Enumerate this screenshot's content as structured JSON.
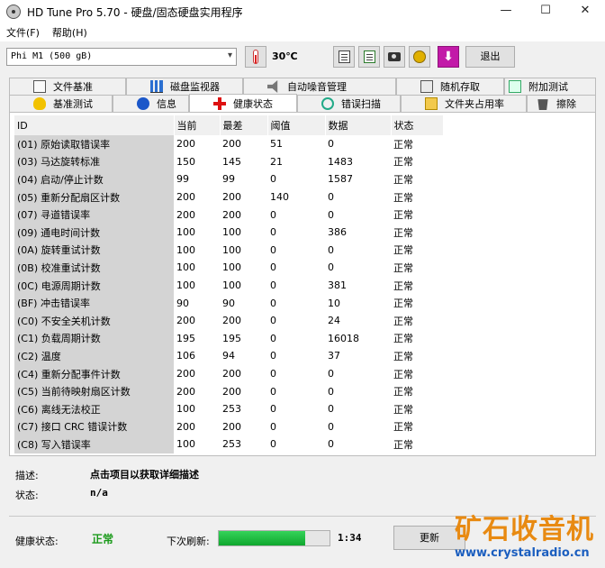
{
  "window": {
    "title": "HD Tune Pro 5.70 - 硬盘/固态硬盘实用程序",
    "controls": {
      "minimize": "—",
      "maximize": "☐",
      "close": "✕"
    }
  },
  "menu": {
    "file": "文件(F)",
    "help": "帮助(H)"
  },
  "toolbar": {
    "drive": "Phi     M1 (500 gB)",
    "temperature": "30℃",
    "exit_label": "退出",
    "icons": [
      "thermometer-icon",
      "copy-text-icon",
      "copy-report-icon",
      "camera-icon",
      "coins-icon",
      "download-icon"
    ]
  },
  "tabs": {
    "row1": [
      "文件基准",
      "磁盘监视器",
      "自动噪音管理",
      "随机存取",
      "附加测试"
    ],
    "row2": [
      "基准测试",
      "信息",
      "健康状态",
      "错误扫描",
      "文件夹占用率",
      "擦除"
    ],
    "active": "健康状态"
  },
  "health_table": {
    "headers": [
      "ID",
      "当前",
      "最差",
      "阈值",
      "数据",
      "状态"
    ],
    "rows": [
      [
        "(01) 原始读取错误率",
        "200",
        "200",
        "51",
        "0",
        "正常"
      ],
      [
        "(03) 马达旋转标准",
        "150",
        "145",
        "21",
        "1483",
        "正常"
      ],
      [
        "(04) 启动/停止计数",
        "99",
        "99",
        "0",
        "1587",
        "正常"
      ],
      [
        "(05) 重新分配扇区计数",
        "200",
        "200",
        "140",
        "0",
        "正常"
      ],
      [
        "(07) 寻道错误率",
        "200",
        "200",
        "0",
        "0",
        "正常"
      ],
      [
        "(09) 通电时间计数",
        "100",
        "100",
        "0",
        "386",
        "正常"
      ],
      [
        "(0A) 旋转重试计数",
        "100",
        "100",
        "0",
        "0",
        "正常"
      ],
      [
        "(0B) 校准重试计数",
        "100",
        "100",
        "0",
        "0",
        "正常"
      ],
      [
        "(0C) 电源周期计数",
        "100",
        "100",
        "0",
        "381",
        "正常"
      ],
      [
        "(BF) 冲击错误率",
        "90",
        "90",
        "0",
        "10",
        "正常"
      ],
      [
        "(C0) 不安全关机计数",
        "200",
        "200",
        "0",
        "24",
        "正常"
      ],
      [
        "(C1) 负载周期计数",
        "195",
        "195",
        "0",
        "16018",
        "正常"
      ],
      [
        "(C2) 温度",
        "106",
        "94",
        "0",
        "37",
        "正常"
      ],
      [
        "(C4) 重新分配事件计数",
        "200",
        "200",
        "0",
        "0",
        "正常"
      ],
      [
        "(C5) 当前待映射扇区计数",
        "200",
        "200",
        "0",
        "0",
        "正常"
      ],
      [
        "(C6) 离线无法校正",
        "100",
        "253",
        "0",
        "0",
        "正常"
      ],
      [
        "(C7) 接口 CRC 错误计数",
        "200",
        "200",
        "0",
        "0",
        "正常"
      ],
      [
        "(C8) 写入错误率",
        "100",
        "253",
        "0",
        "0",
        "正常"
      ]
    ]
  },
  "description": {
    "desc_label": "描述:",
    "desc_value": "点击项目以获取详细描述",
    "status_label": "状态:",
    "status_value": "n/a"
  },
  "status_bar": {
    "health_label": "健康状态:",
    "health_value": "正常",
    "health_color": "#1a9a1a",
    "next_refresh_label": "下次刷新:",
    "refresh_progress": 0.78,
    "countdown": "1:34",
    "refresh_button": "更新"
  },
  "watermark": {
    "brand": "矿石收音机",
    "url": "www.crystalradio.cn"
  }
}
